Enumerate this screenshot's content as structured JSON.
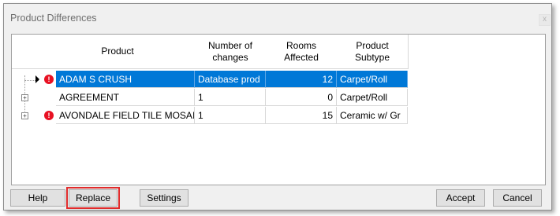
{
  "window": {
    "title": "Product Differences",
    "close_glyph": "x"
  },
  "table": {
    "headers": [
      "Product",
      "Number of\nchanges",
      "Rooms\nAffected",
      "Product\nSubtype"
    ],
    "rows": [
      {
        "product": "ADAM S CRUSH",
        "changes": "Database prod",
        "rooms": "12",
        "subtype": "Carpet/Roll",
        "selected": true,
        "warning": true
      },
      {
        "product": "AGREEMENT",
        "changes": "1",
        "rooms": "0",
        "subtype": "Carpet/Roll",
        "selected": false,
        "warning": false
      },
      {
        "product": "AVONDALE FIELD TILE MOSAIC",
        "changes": "1",
        "rooms": "15",
        "subtype": "Ceramic w/ Gr",
        "selected": false,
        "warning": true
      }
    ]
  },
  "buttons": {
    "help": "Help",
    "replace": "Replace",
    "settings": "Settings",
    "accept": "Accept",
    "cancel": "Cancel"
  },
  "icons": {
    "warning": "!",
    "expand": "+"
  },
  "colors": {
    "selection": "#0078d7",
    "warning": "#e81123",
    "highlight_border": "#e02b2b"
  }
}
